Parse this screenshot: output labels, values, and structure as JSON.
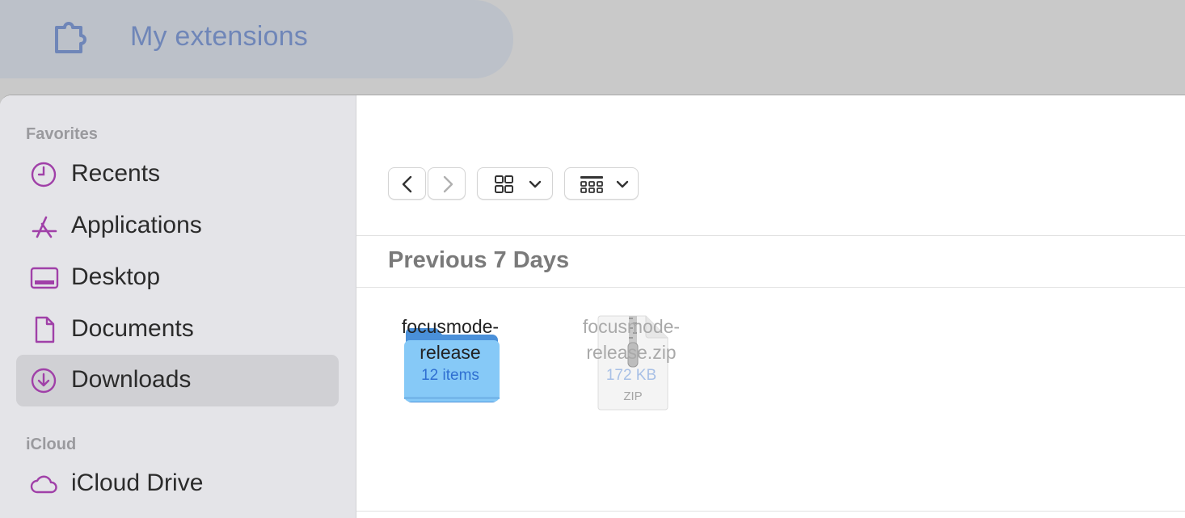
{
  "header": {
    "title": "My extensions",
    "icon": "puzzle-piece-icon"
  },
  "sidebar": {
    "favorites_label": "Favorites",
    "items": [
      {
        "label": "Recents",
        "icon": "clock-icon"
      },
      {
        "label": "Applications",
        "icon": "applications-icon"
      },
      {
        "label": "Desktop",
        "icon": "desktop-icon"
      },
      {
        "label": "Documents",
        "icon": "document-icon"
      },
      {
        "label": "Downloads",
        "icon": "download-icon",
        "selected": true
      }
    ],
    "icloud_label": "iCloud",
    "icloud_items": [
      {
        "label": "iCloud Drive",
        "icon": "cloud-icon"
      }
    ]
  },
  "toolbar": {
    "back": "back-chevron-icon",
    "forward": "forward-chevron-icon",
    "view_mode": "icon-grid-icon",
    "group_by": "group-grid-icon"
  },
  "group": {
    "header": "Previous 7 Days"
  },
  "files": [
    {
      "name_line1": "focusmode-",
      "name_line2": "release",
      "meta": "12 items",
      "type": "folder"
    },
    {
      "name_line1": "focusmode-",
      "name_line2": "release.zip",
      "meta": "172 KB",
      "type": "zip",
      "badge": "ZIP"
    }
  ],
  "colors": {
    "accent": "#a040a8",
    "folder": "#6fb6ef",
    "selected_bg": "#d0d0d4"
  }
}
